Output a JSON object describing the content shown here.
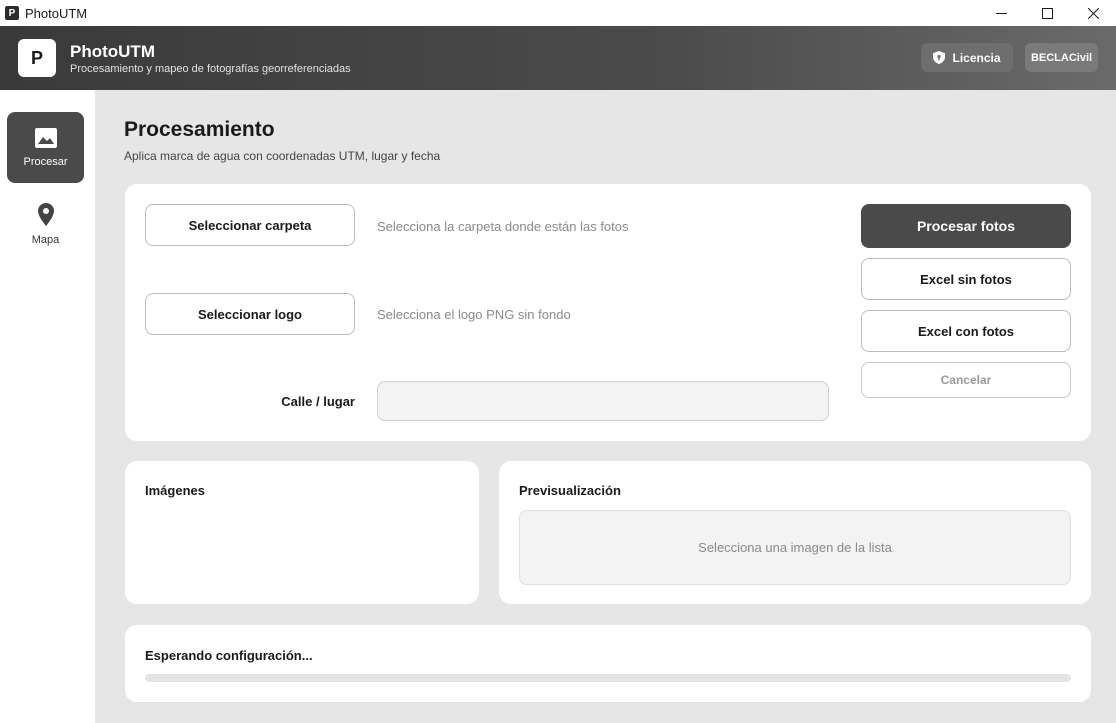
{
  "window": {
    "title": "PhotoUTM",
    "icon_letter": "P"
  },
  "header": {
    "logo_letter": "P",
    "app_name": "PhotoUTM",
    "subtitle": "Procesamiento y mapeo de fotografías georreferenciadas",
    "license_label": "Licencia",
    "user_label": "BECLACivil"
  },
  "sidebar": {
    "items": [
      {
        "label": "Procesar",
        "icon": "image-icon",
        "active": true
      },
      {
        "label": "Mapa",
        "icon": "map-pin-icon",
        "active": false
      }
    ]
  },
  "main": {
    "title": "Procesamiento",
    "subtitle": "Aplica marca de agua con coordenadas UTM, lugar y fecha"
  },
  "config": {
    "folder_button": "Seleccionar carpeta",
    "folder_hint": "Selecciona la carpeta donde están las fotos",
    "logo_button": "Seleccionar logo",
    "logo_hint": "Selecciona el logo PNG sin fondo",
    "street_label": "Calle / lugar",
    "street_value": "",
    "street_placeholder": ""
  },
  "actions": {
    "process": "Procesar fotos",
    "excel_no_photos": "Excel sin fotos",
    "excel_with_photos": "Excel con fotos",
    "cancel": "Cancelar"
  },
  "images_panel": {
    "title": "Imágenes",
    "items": []
  },
  "preview_panel": {
    "title": "Previsualización",
    "placeholder": "Selecciona una imagen de la lista"
  },
  "status": {
    "text": "Esperando configuración...",
    "progress": 0
  },
  "colors": {
    "accent_dark": "#4a4a4a",
    "background": "#e6e6e6",
    "card": "#ffffff"
  }
}
